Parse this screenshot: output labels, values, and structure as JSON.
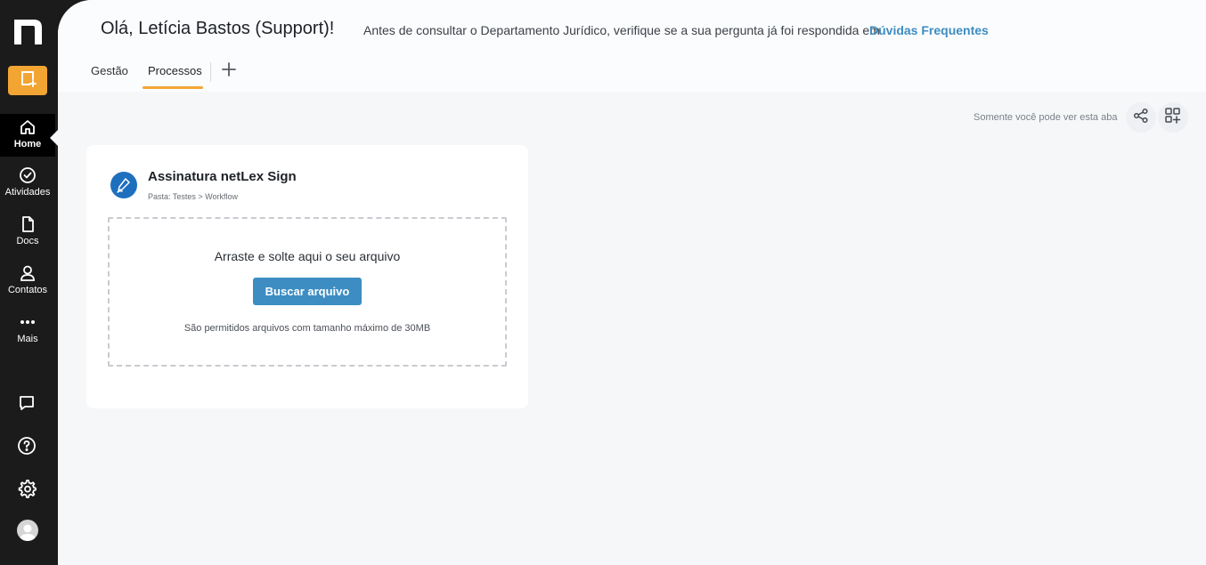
{
  "sidebar": {
    "logo": "n",
    "new_button_icon": "new-document-icon",
    "items": [
      {
        "label": "Home",
        "icon": "home-icon"
      },
      {
        "label": "Atividades",
        "icon": "check-circle-icon"
      },
      {
        "label": "Docs",
        "icon": "document-icon"
      },
      {
        "label": "Contatos",
        "icon": "user-icon"
      },
      {
        "label": "Mais",
        "icon": "more-icon"
      }
    ],
    "bottom": [
      "chat-icon",
      "help-icon",
      "gear-icon",
      "avatar"
    ]
  },
  "header": {
    "greeting": "Olá, Letícia Bastos (Support)!",
    "notice": "Antes de consultar o Departamento Jurídico, verifique se a sua pergunta já foi respondida em",
    "faq_link": "Dúvidas Frequentes"
  },
  "tabs": [
    {
      "label": "Gestão",
      "active": false
    },
    {
      "label": "Processos",
      "active": true
    }
  ],
  "toolbar": {
    "visibility": "Somente você pode ver esta aba"
  },
  "card": {
    "title": "Assinatura netLex Sign",
    "path": "Pasta: Testes > Workflow",
    "drop_text": "Arraste e solte aqui o seu arquivo",
    "browse_label": "Buscar arquivo",
    "limit_text": "São permitidos arquivos com tamanho máximo de 30MB"
  },
  "colors": {
    "accent": "#f3a533",
    "link": "#3d8dc3",
    "sidebar": "#1b1b1b"
  }
}
